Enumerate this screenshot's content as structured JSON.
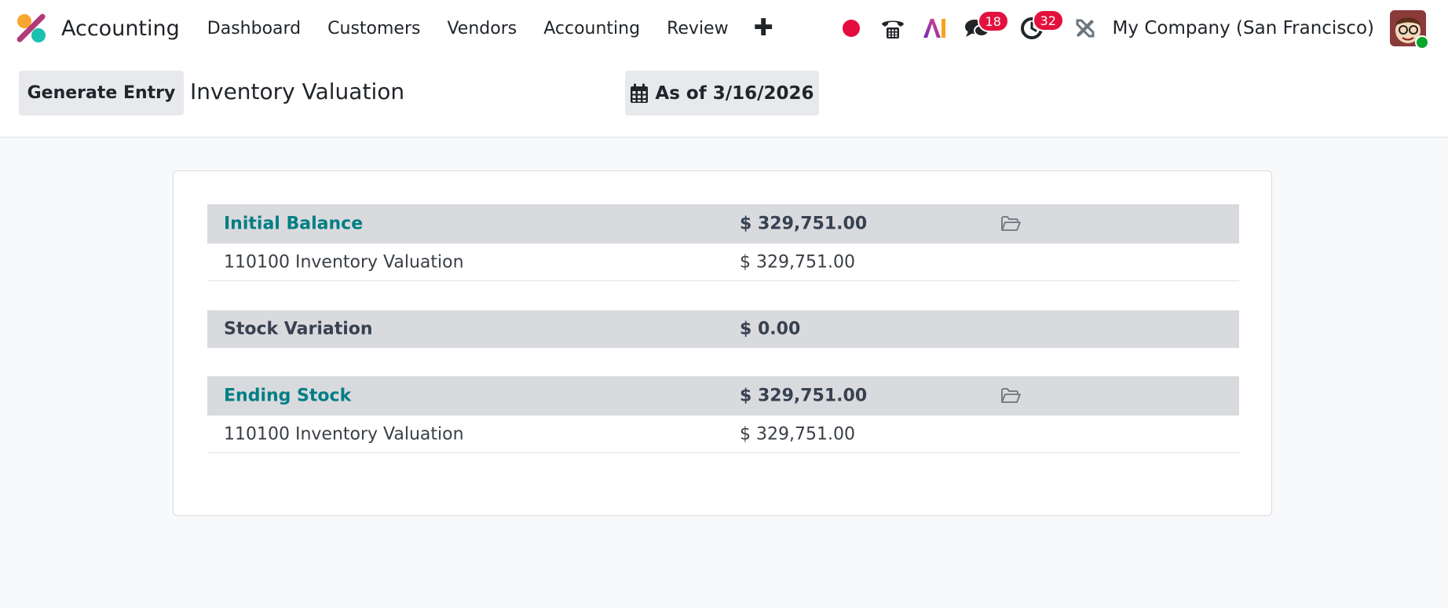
{
  "app": {
    "name": "Accounting",
    "logo_icon": "odoo-accounting-logo-icon"
  },
  "menu": {
    "items": [
      "Dashboard",
      "Customers",
      "Vendors",
      "Accounting",
      "Review"
    ],
    "plus_label": "✚"
  },
  "systray": {
    "messages_count": "18",
    "activities_count": "32",
    "company": "My Company (San Francisco)",
    "recording_color": "#e40d40",
    "badge_color": "#e3113e",
    "online_color": "#0aa52b"
  },
  "control_panel": {
    "generate_label": "Generate Entry",
    "title": "Inventory Valuation",
    "date_label": "As of 3/16/2026"
  },
  "report": {
    "accent_color": "#017e84",
    "sections": [
      {
        "label": "Initial Balance",
        "total": "$ 329,751.00",
        "style": "link",
        "has_folder": true,
        "lines": [
          {
            "label": "110100 Inventory Valuation",
            "value": "$ 329,751.00"
          }
        ]
      },
      {
        "label": "Stock Variation",
        "total": "$ 0.00",
        "style": "dark",
        "has_folder": false,
        "lines": []
      },
      {
        "label": "Ending Stock",
        "total": "$ 329,751.00",
        "style": "link",
        "has_folder": true,
        "lines": [
          {
            "label": "110100 Inventory Valuation",
            "value": "$ 329,751.00"
          }
        ]
      }
    ]
  }
}
